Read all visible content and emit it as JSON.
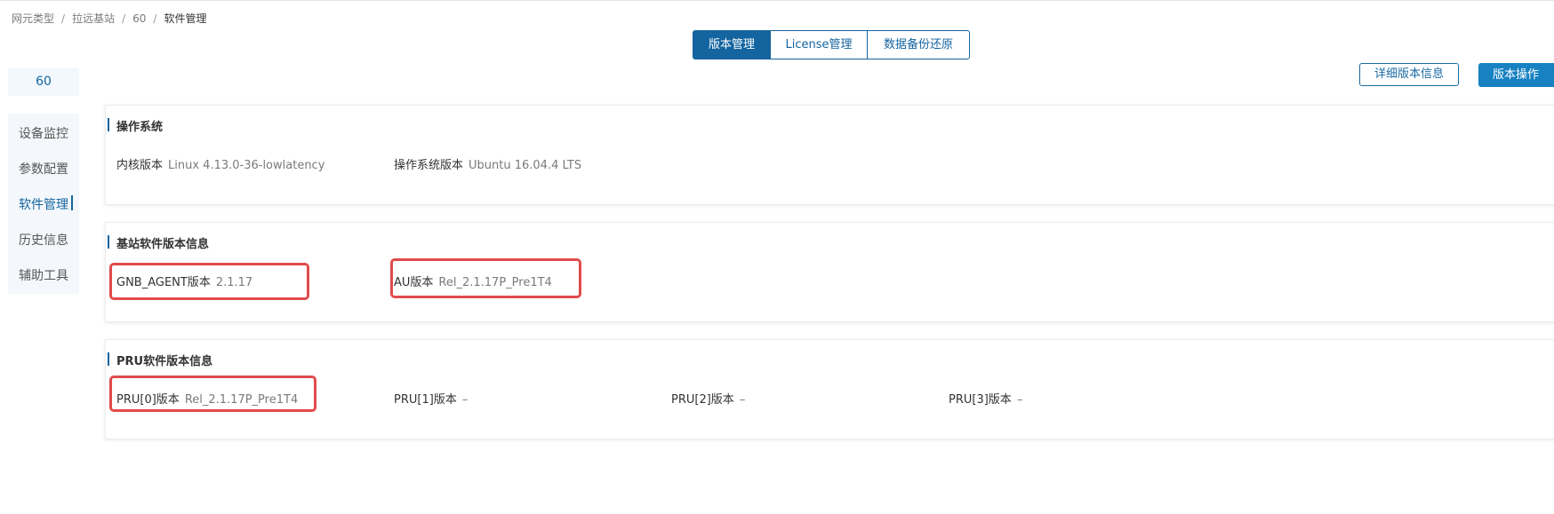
{
  "breadcrumb": {
    "items": [
      "网元类型",
      "拉远基站",
      "60"
    ],
    "current": "软件管理",
    "separator": "/"
  },
  "tabs": [
    "版本管理",
    "License管理",
    "数据备份还原"
  ],
  "active_tab_index": 0,
  "sidebar": {
    "node": "60",
    "items": [
      "设备监控",
      "参数配置",
      "软件管理",
      "历史信息",
      "辅助工具"
    ],
    "active_index": 2
  },
  "actions": {
    "detail_label": "详细版本信息",
    "operate_label": "版本操作"
  },
  "os_section": {
    "title": "操作系统",
    "fields": [
      {
        "label": "内核版本",
        "value": "Linux 4.13.0-36-lowlatency"
      },
      {
        "label": "操作系统版本",
        "value": "Ubuntu 16.04.4 LTS"
      }
    ]
  },
  "bs_section": {
    "title": "基站软件版本信息",
    "fields": [
      {
        "label": "GNB_AGENT版本",
        "value": "2.1.17"
      },
      {
        "label": "AU版本",
        "value": "Rel_2.1.17P_Pre1T4"
      }
    ]
  },
  "pru_section": {
    "title": "PRU软件版本信息",
    "fields": [
      {
        "label": "PRU[0]版本",
        "value": "Rel_2.1.17P_Pre1T4"
      },
      {
        "label": "PRU[1]版本",
        "value": "–"
      },
      {
        "label": "PRU[2]版本",
        "value": "–"
      },
      {
        "label": "PRU[3]版本",
        "value": "–"
      }
    ]
  },
  "colors": {
    "accent": "#1464a0",
    "primary_button": "#1781c2",
    "highlight_box": "#e14b4b"
  }
}
